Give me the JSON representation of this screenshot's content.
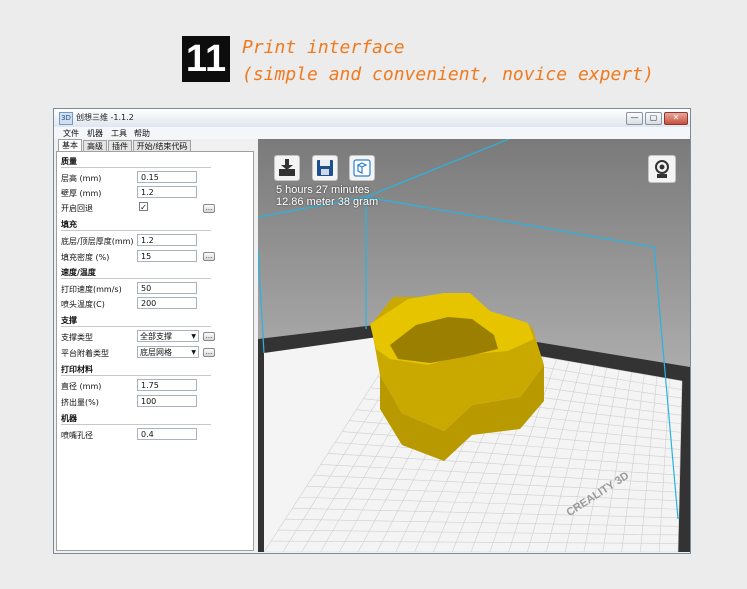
{
  "banner": {
    "number": "11",
    "title": "Print interface",
    "subtitle": "(simple and convenient, novice expert)"
  },
  "window": {
    "title": "创想三维 -1.1.2",
    "icon_text": "3D",
    "controls": {
      "minimize": "—",
      "maximize": "▢",
      "close": "✕"
    }
  },
  "menu": [
    "文件",
    "机器",
    "工具",
    "帮助"
  ],
  "tabs": [
    "基本",
    "高级",
    "插件",
    "开始/结束代码"
  ],
  "settings": {
    "quality": {
      "header": "质量",
      "layer_height_label": "层高 (mm)",
      "layer_height": "0.15",
      "wall_label": "壁厚 (mm)",
      "wall": "1.2",
      "retraction_label": "开启回退",
      "retraction": "✓"
    },
    "fill": {
      "header": "填充",
      "bottom_top_label": "底层/顶层厚度(mm)",
      "bottom_top": "1.2",
      "density_label": "填充密度 (%)",
      "density": "15"
    },
    "speed": {
      "header": "速度/温度",
      "print_speed_label": "打印速度(mm/s)",
      "print_speed": "50",
      "nozzle_temp_label": "喷头温度(C)",
      "nozzle_temp": "200"
    },
    "support": {
      "header": "支撑",
      "support_type_label": "支撑类型",
      "support_type": "全部支撑",
      "adhesion_label": "平台附着类型",
      "adhesion": "底层网格"
    },
    "filament": {
      "header": "打印材料",
      "diameter_label": "直径 (mm)",
      "diameter": "1.75",
      "flow_label": "挤出量(%)",
      "flow": "100"
    },
    "machine": {
      "header": "机器",
      "nozzle_label": "喷嘴孔径",
      "nozzle": "0.4"
    },
    "more_label": "..."
  },
  "viewport": {
    "print_time": "5 hours 27 minutes",
    "print_stats": "12.86 meter 38 gram",
    "brand": "CREALITY 3D",
    "model_color": "#e6c400",
    "bed_color": "#f4f4f4",
    "axis_color": "#27b4e0"
  }
}
